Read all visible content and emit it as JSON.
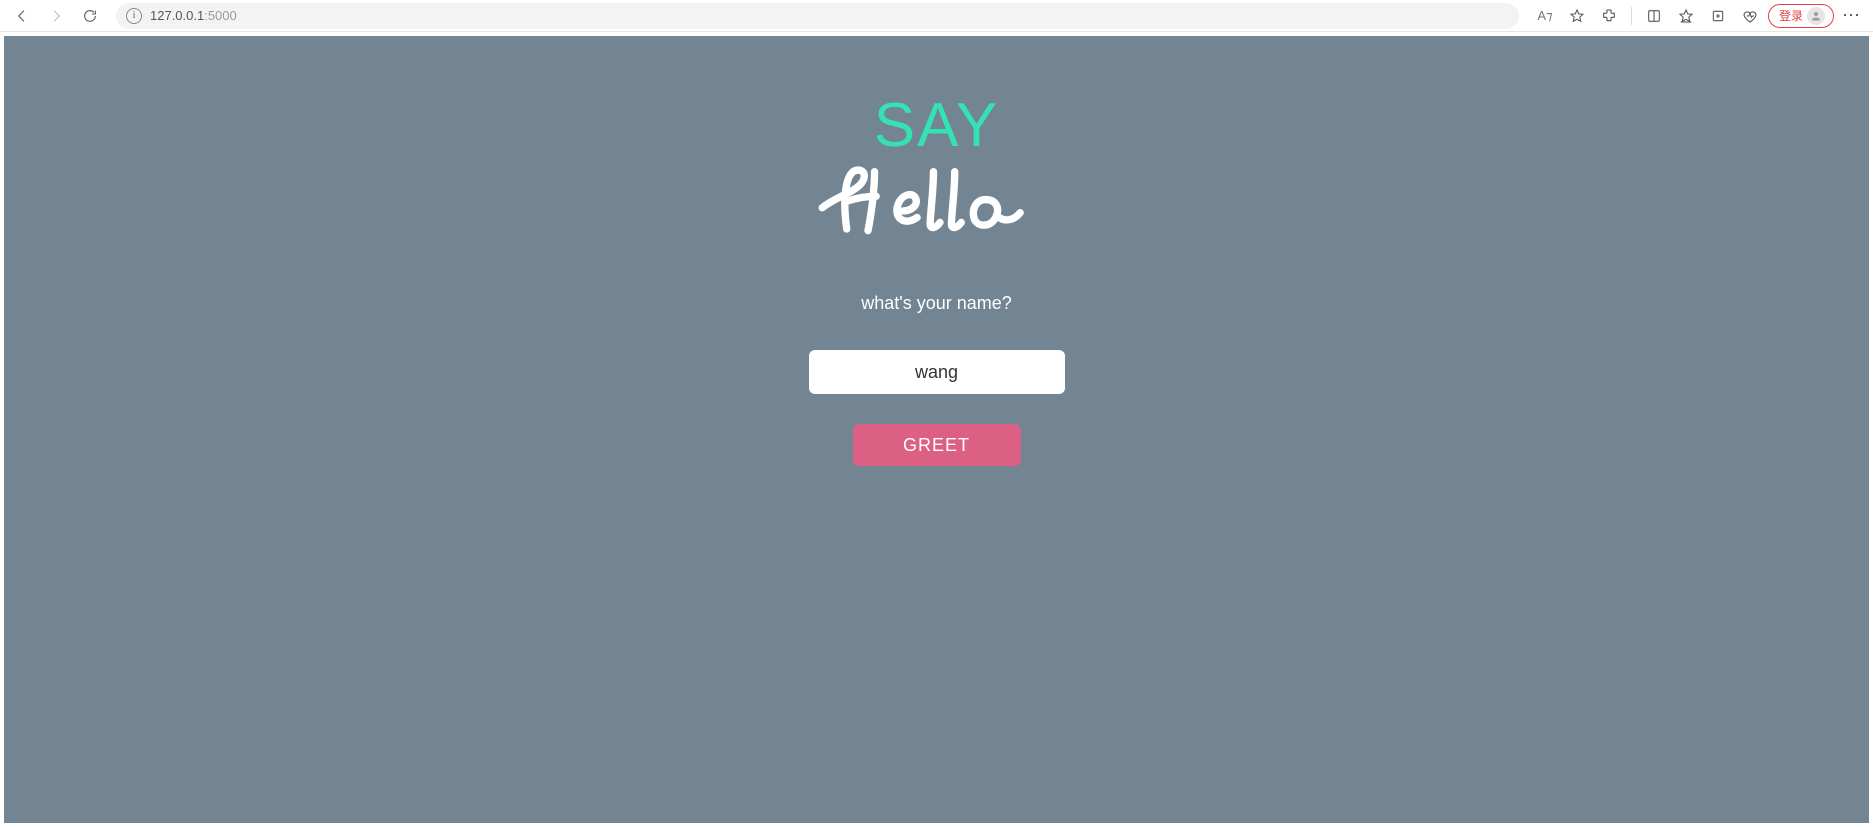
{
  "browser": {
    "url_host": "127.0.0.1",
    "url_port": ":5000",
    "login_label": "登录",
    "read_aloud_label": "A⁊"
  },
  "page": {
    "title_top": "SAY",
    "title_bottom": "Hello",
    "prompt": "what's your name?",
    "name_value": "wang",
    "greet_label": "GREET"
  },
  "colors": {
    "page_bg": "#738493",
    "accent_teal": "#34e2b4",
    "button_pink": "#dc6084"
  }
}
